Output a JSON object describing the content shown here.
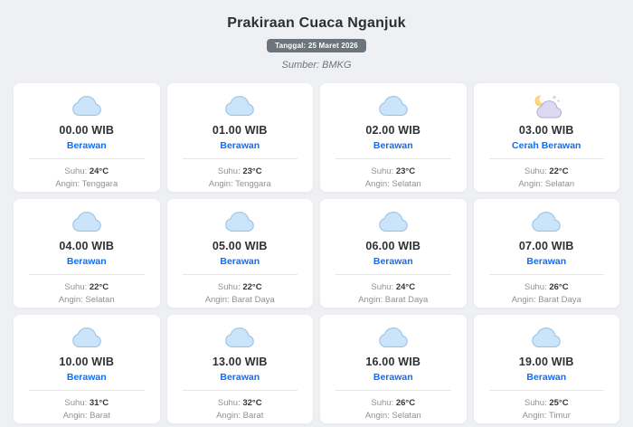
{
  "page": {
    "title": "Prakiraan Cuaca Nganjuk",
    "date_badge": "Tanggal: 25 Maret 2026",
    "source": "Sumber: BMKG"
  },
  "labels": {
    "temp": "Suhu:",
    "wind": "Angin:"
  },
  "colors": {
    "condition_text": "#0d6efd",
    "badge_bg": "#6c757d",
    "page_bg": "#eef0f3",
    "cloud_fill": "#cbe4f9",
    "cloud_stroke": "#9cc6e8",
    "night_cloud_fill": "#ded9f2",
    "night_cloud_stroke": "#b4aad8",
    "moon_fill": "#f7d983"
  },
  "cards": [
    {
      "time": "00.00 WIB",
      "condition": "Berawan",
      "icon": "cloud-icon",
      "temp": "24°C",
      "wind": "Tenggara"
    },
    {
      "time": "01.00 WIB",
      "condition": "Berawan",
      "icon": "cloud-icon",
      "temp": "23°C",
      "wind": "Tenggara"
    },
    {
      "time": "02.00 WIB",
      "condition": "Berawan",
      "icon": "cloud-icon",
      "temp": "23°C",
      "wind": "Selatan"
    },
    {
      "time": "03.00 WIB",
      "condition": "Cerah Berawan",
      "icon": "moon-cloud-icon",
      "temp": "22°C",
      "wind": "Selatan"
    },
    {
      "time": "04.00 WIB",
      "condition": "Berawan",
      "icon": "cloud-icon",
      "temp": "22°C",
      "wind": "Selatan"
    },
    {
      "time": "05.00 WIB",
      "condition": "Berawan",
      "icon": "cloud-icon",
      "temp": "22°C",
      "wind": "Barat Daya"
    },
    {
      "time": "06.00 WIB",
      "condition": "Berawan",
      "icon": "cloud-icon",
      "temp": "24°C",
      "wind": "Barat Daya"
    },
    {
      "time": "07.00 WIB",
      "condition": "Berawan",
      "icon": "cloud-icon",
      "temp": "26°C",
      "wind": "Barat Daya"
    },
    {
      "time": "10.00 WIB",
      "condition": "Berawan",
      "icon": "cloud-icon",
      "temp": "31°C",
      "wind": "Barat"
    },
    {
      "time": "13.00 WIB",
      "condition": "Berawan",
      "icon": "cloud-icon",
      "temp": "32°C",
      "wind": "Barat"
    },
    {
      "time": "16.00 WIB",
      "condition": "Berawan",
      "icon": "cloud-icon",
      "temp": "26°C",
      "wind": "Selatan"
    },
    {
      "time": "19.00 WIB",
      "condition": "Berawan",
      "icon": "cloud-icon",
      "temp": "25°C",
      "wind": "Timur"
    }
  ]
}
